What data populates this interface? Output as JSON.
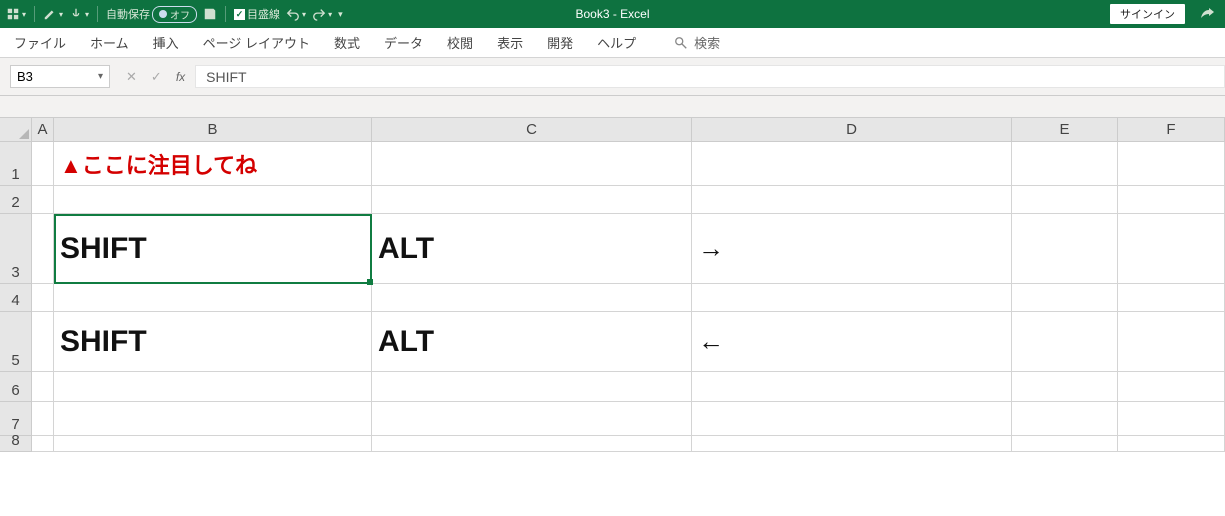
{
  "title": "Book3 - Excel",
  "signin": "サインイン",
  "qat": {
    "autosave_label": "自動保存",
    "autosave_state": "オフ",
    "gridlines_label": "目盛線"
  },
  "tabs": [
    "ファイル",
    "ホーム",
    "挿入",
    "ページ レイアウト",
    "数式",
    "データ",
    "校閲",
    "表示",
    "開発",
    "ヘルプ"
  ],
  "search_placeholder": "検索",
  "namebox": "B3",
  "formula": "SHIFT",
  "columns": [
    "A",
    "B",
    "C",
    "D",
    "E",
    "F"
  ],
  "rows": [
    "1",
    "2",
    "3",
    "4",
    "5",
    "6",
    "7",
    "8"
  ],
  "cells": {
    "B1": "▲ここに注目してね",
    "B3": "SHIFT",
    "C3": "ALT",
    "D3": "→",
    "B5": "SHIFT",
    "C5": "ALT",
    "D5": "←"
  },
  "selected": "B3"
}
